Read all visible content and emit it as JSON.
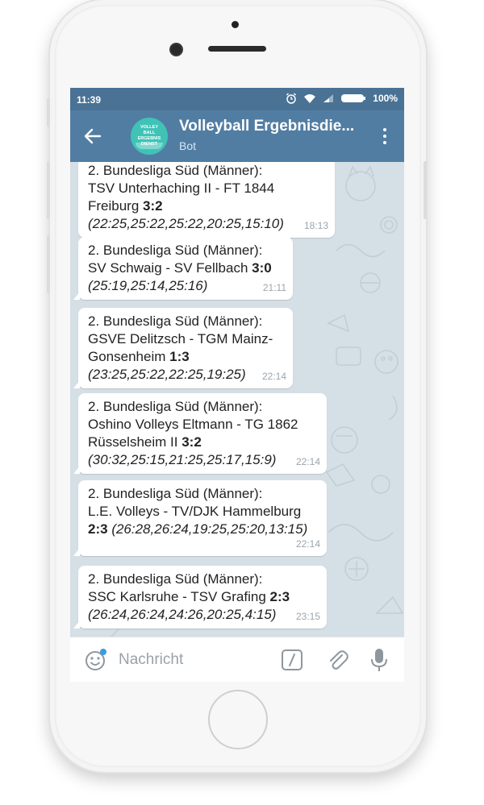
{
  "status_bar": {
    "time": "11:39",
    "battery": "100%",
    "icons": [
      "alarm-clock-icon",
      "wifi-icon",
      "signal-icon",
      "battery-icon"
    ]
  },
  "header": {
    "title": "Volleyball Ergebnisdie...",
    "subtitle": "Bot",
    "avatar_lines": [
      "VOLLEY",
      "BALL",
      "ERGEBNIS",
      "DIENST"
    ],
    "bg_color": "#527da3",
    "status_color": "#4a7295"
  },
  "messages": [
    {
      "lines": [
        "2. Bundesliga Süd (Männer):",
        "TSV Unterhaching II - FT 1844"
      ],
      "score_prefix": "Freiburg ",
      "score": "3:2",
      "score_suffix": "",
      "sets": "(22:25,25:22,25:22,20:25,15:10)",
      "time": "18:13"
    },
    {
      "lines": [
        "2. Bundesliga Süd (Männer):"
      ],
      "score_prefix": "SV Schwaig - SV Fellbach ",
      "score": "3:0",
      "score_suffix": "",
      "sets": "(25:19,25:14,25:16)",
      "time": "21:11"
    },
    {
      "lines": [
        "2. Bundesliga Süd (Männer):",
        "GSVE Delitzsch - TGM Mainz-"
      ],
      "score_prefix": "Gonsenheim ",
      "score": "1:3",
      "score_suffix": "",
      "sets": "(23:25,25:22,22:25,19:25)",
      "time": "22:14"
    },
    {
      "lines": [
        "2. Bundesliga Süd (Männer):",
        "Oshino Volleys Eltmann - TG 1862"
      ],
      "score_prefix": "Rüsselsheim II ",
      "score": "3:2",
      "score_suffix": "",
      "sets": "(30:32,25:15,21:25,25:17,15:9)",
      "time": "22:14"
    },
    {
      "lines": [
        "2. Bundesliga Süd (Männer):",
        "L.E. Volleys - TV/DJK Hammelburg"
      ],
      "score_prefix": "",
      "score": "2:3",
      "score_suffix": " ",
      "sets": "(26:28,26:24,19:25,25:20,13:15)",
      "time": "22:14"
    },
    {
      "lines": [
        "2. Bundesliga Süd (Männer):"
      ],
      "score_prefix": "SSC Karlsruhe - TSV Grafing ",
      "score": "2:3",
      "score_suffix": "",
      "sets": "(26:24,26:24,24:26,20:25,4:15)",
      "time": "23:15"
    }
  ],
  "input": {
    "placeholder": "Nachricht",
    "value": ""
  },
  "colors": {
    "chat_bg": "#d5dfe6",
    "bubble": "#ffffff",
    "time": "#9aa5ad"
  }
}
